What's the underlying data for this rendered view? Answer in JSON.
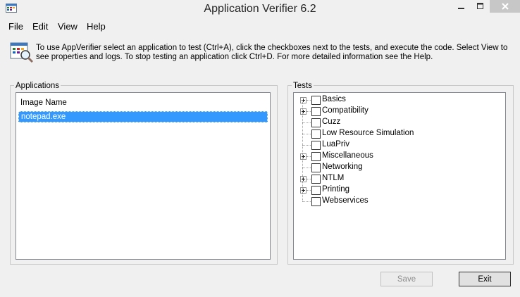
{
  "window": {
    "title": "Application Verifier 6.2",
    "controls": {
      "minimize": "minimize-icon",
      "maximize": "maximize-icon",
      "close": "close-icon"
    }
  },
  "menu": {
    "items": [
      {
        "label": "File"
      },
      {
        "label": "Edit"
      },
      {
        "label": "View"
      },
      {
        "label": "Help"
      }
    ]
  },
  "info": {
    "text": "To use AppVerifier select an application to test (Ctrl+A), click the checkboxes next to the tests, and execute the code. Select View to see properties and logs. To stop testing an application click Ctrl+D. For more detailed information see the Help."
  },
  "applications": {
    "group_label": "Applications",
    "column_header": "Image Name",
    "rows": [
      {
        "name": "notepad.exe",
        "selected": true
      }
    ]
  },
  "tests": {
    "group_label": "Tests",
    "items": [
      {
        "label": "Basics",
        "expandable": true,
        "checked": false
      },
      {
        "label": "Compatibility",
        "expandable": true,
        "checked": false
      },
      {
        "label": "Cuzz",
        "expandable": false,
        "checked": false
      },
      {
        "label": "Low Resource Simulation",
        "expandable": false,
        "checked": false
      },
      {
        "label": "LuaPriv",
        "expandable": false,
        "checked": false
      },
      {
        "label": "Miscellaneous",
        "expandable": true,
        "checked": false
      },
      {
        "label": "Networking",
        "expandable": false,
        "checked": false
      },
      {
        "label": "NTLM",
        "expandable": true,
        "checked": false
      },
      {
        "label": "Printing",
        "expandable": true,
        "checked": false
      },
      {
        "label": "Webservices",
        "expandable": false,
        "checked": false
      }
    ]
  },
  "buttons": {
    "save": {
      "label": "Save",
      "enabled": false
    },
    "exit": {
      "label": "Exit",
      "enabled": true
    }
  },
  "colors": {
    "selection": "#3399ff",
    "window_bg": "#f0f0f0",
    "close_button_bg": "#c7c7c7"
  }
}
